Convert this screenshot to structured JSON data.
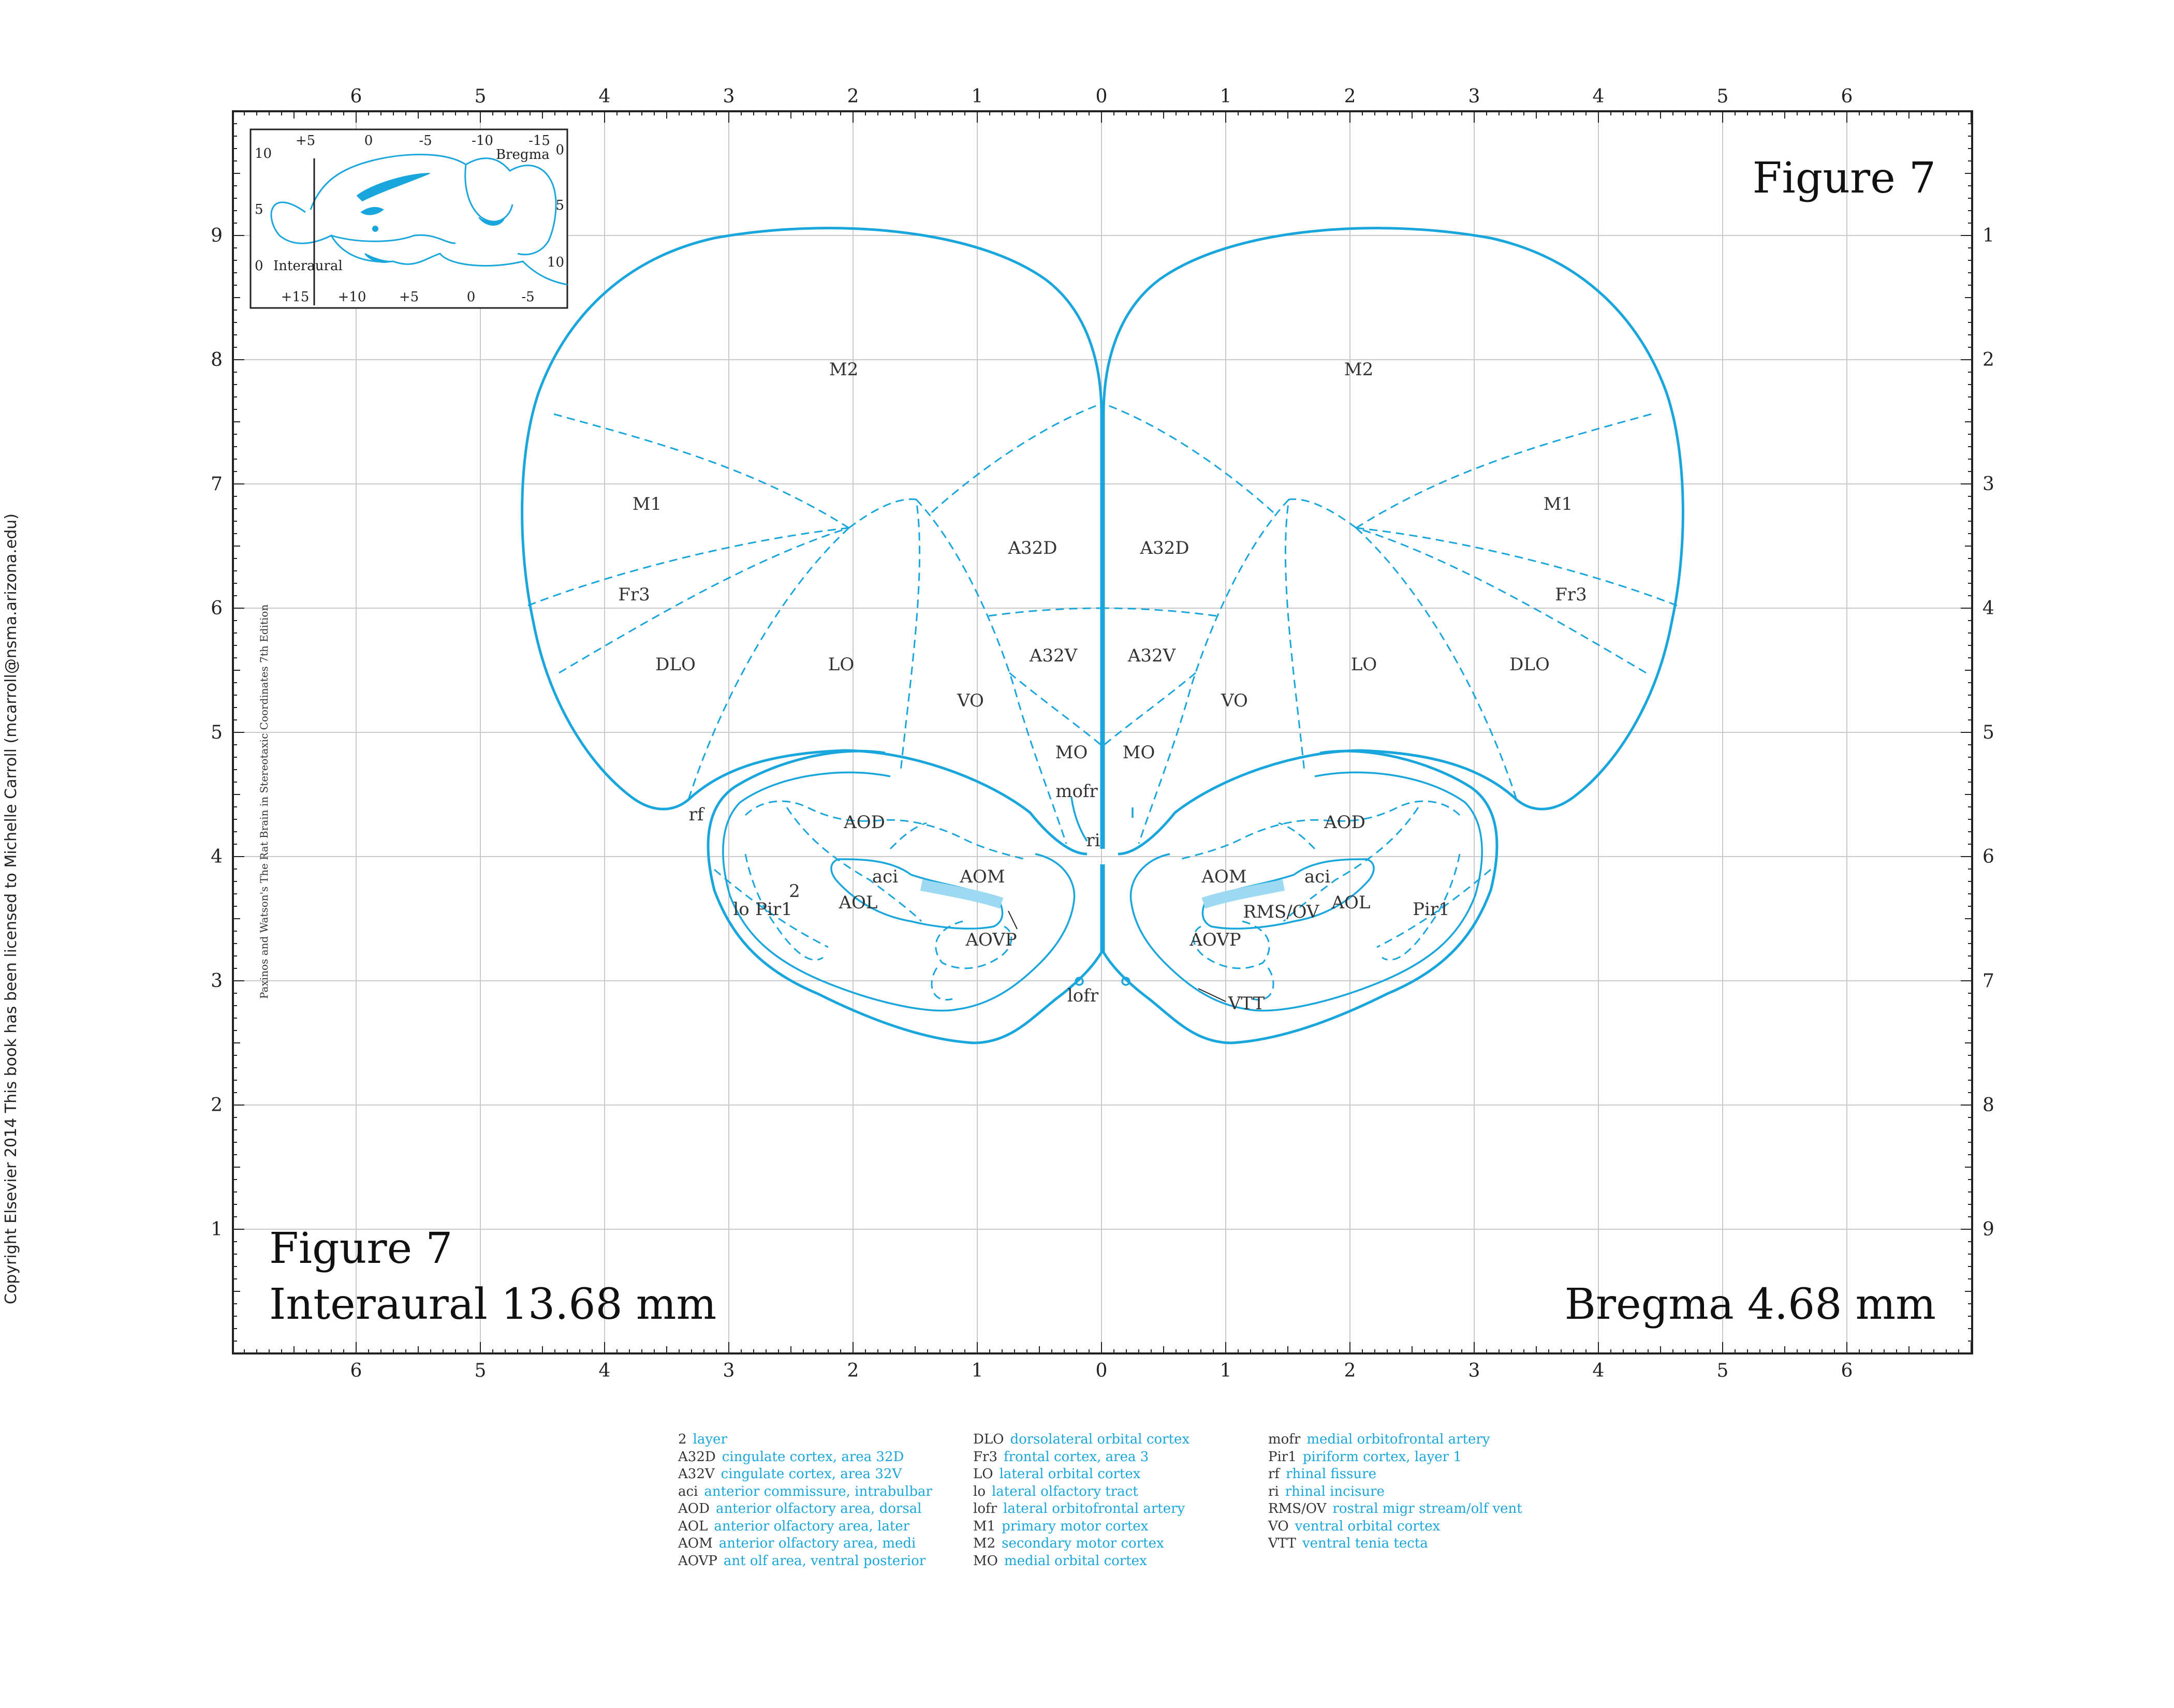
{
  "figure": {
    "title": "Figure 7",
    "interaural": "Interaural 13.68 mm",
    "bregma": "Bregma 4.68 mm",
    "edition_note": "Paxinos and Watson's The Rat Brain in Stereotaxic Coordinates   7th Edition",
    "copyright": "Copyright Elsevier 2014 This book has been licensed to Michelle Carroll (mcarroll@nsma.arizona.edu)"
  },
  "axes": {
    "top": [
      "6",
      "5",
      "4",
      "3",
      "2",
      "1",
      "0",
      "1",
      "2",
      "3",
      "4",
      "5",
      "6"
    ],
    "bottom": [
      "6",
      "5",
      "4",
      "3",
      "2",
      "1",
      "0",
      "1",
      "2",
      "3",
      "4",
      "5",
      "6"
    ],
    "left": [
      "9",
      "8",
      "7",
      "6",
      "5",
      "4",
      "3",
      "2",
      "1"
    ],
    "right": [
      "1",
      "2",
      "3",
      "4",
      "5",
      "6",
      "7",
      "8",
      "9"
    ]
  },
  "inset": {
    "top_ticks": [
      "+5",
      "0",
      "-5",
      "-10",
      "-15"
    ],
    "bottom_ticks": [
      "+15",
      "+10",
      "+5",
      "0",
      "-5"
    ],
    "left_ticks": [
      "10",
      "5",
      "0"
    ],
    "right_ticks": [
      "0",
      "5",
      "10"
    ],
    "bregma_label": "Bregma",
    "interaural_label": "Interaural"
  },
  "regions": {
    "m2_l": "M2",
    "m2_r": "M2",
    "m1_l": "M1",
    "m1_r": "M1",
    "fr3_l": "Fr3",
    "fr3_r": "Fr3",
    "dlo_l": "DLO",
    "dlo_r": "DLO",
    "lo_l": "LO",
    "lo_r": "LO",
    "vo_l": "VO",
    "vo_r": "VO",
    "a32d_l": "A32D",
    "a32d_r": "A32D",
    "a32v_l": "A32V",
    "a32v_r": "A32V",
    "mo_l": "MO",
    "mo_r": "MO",
    "mofr": "mofr",
    "ri": "ri",
    "rf": "rf",
    "aod_l": "AOD",
    "aod_r": "AOD",
    "aom_l": "AOM",
    "aom_r": "AOM",
    "aci_l": "aci",
    "aci_r": "aci",
    "aol_l": "AOL",
    "aol_r": "AOL",
    "aovp_l": "AOVP",
    "aovp_r": "AOVP",
    "pir1_l": "Pir1",
    "pir1_r": "Pir1",
    "lo_tract": "lo",
    "layer2": "2",
    "lofr": "lofr",
    "rmsov": "RMS/OV",
    "vtt": "VTT"
  },
  "legend": {
    "col1": [
      {
        "abbr": "2",
        "desc": "layer"
      },
      {
        "abbr": "A32D",
        "desc": "cingulate cortex, area 32D"
      },
      {
        "abbr": "A32V",
        "desc": "cingulate cortex, area 32V"
      },
      {
        "abbr": "aci",
        "desc": "anterior commissure, intrabulbar"
      },
      {
        "abbr": "AOD",
        "desc": "anterior olfactory area, dorsal"
      },
      {
        "abbr": "AOL",
        "desc": "anterior olfactory area, later"
      },
      {
        "abbr": "AOM",
        "desc": "anterior olfactory area, medi"
      },
      {
        "abbr": "AOVP",
        "desc": "ant olf area, ventral posterior"
      }
    ],
    "col2": [
      {
        "abbr": "DLO",
        "desc": "dorsolateral orbital cortex"
      },
      {
        "abbr": "Fr3",
        "desc": "frontal cortex, area 3"
      },
      {
        "abbr": "LO",
        "desc": "lateral orbital cortex"
      },
      {
        "abbr": "lo",
        "desc": "lateral olfactory tract"
      },
      {
        "abbr": "lofr",
        "desc": "lateral orbitofrontal artery"
      },
      {
        "abbr": "M1",
        "desc": "primary motor cortex"
      },
      {
        "abbr": "M2",
        "desc": "secondary motor cortex"
      },
      {
        "abbr": "MO",
        "desc": "medial orbital cortex"
      }
    ],
    "col3": [
      {
        "abbr": "mofr",
        "desc": "medial orbitofrontal artery"
      },
      {
        "abbr": "Pir1",
        "desc": "piriform cortex, layer 1"
      },
      {
        "abbr": "rf",
        "desc": "rhinal fissure"
      },
      {
        "abbr": "ri",
        "desc": "rhinal incisure"
      },
      {
        "abbr": "RMS/OV",
        "desc": "rostral migr stream/olf vent"
      },
      {
        "abbr": "VO",
        "desc": "ventral orbital cortex"
      },
      {
        "abbr": "VTT",
        "desc": "ventral tenia tecta"
      }
    ]
  },
  "colors": {
    "accent": "#18a6dc",
    "grid": "#c8c8c8",
    "text": "#222222"
  }
}
